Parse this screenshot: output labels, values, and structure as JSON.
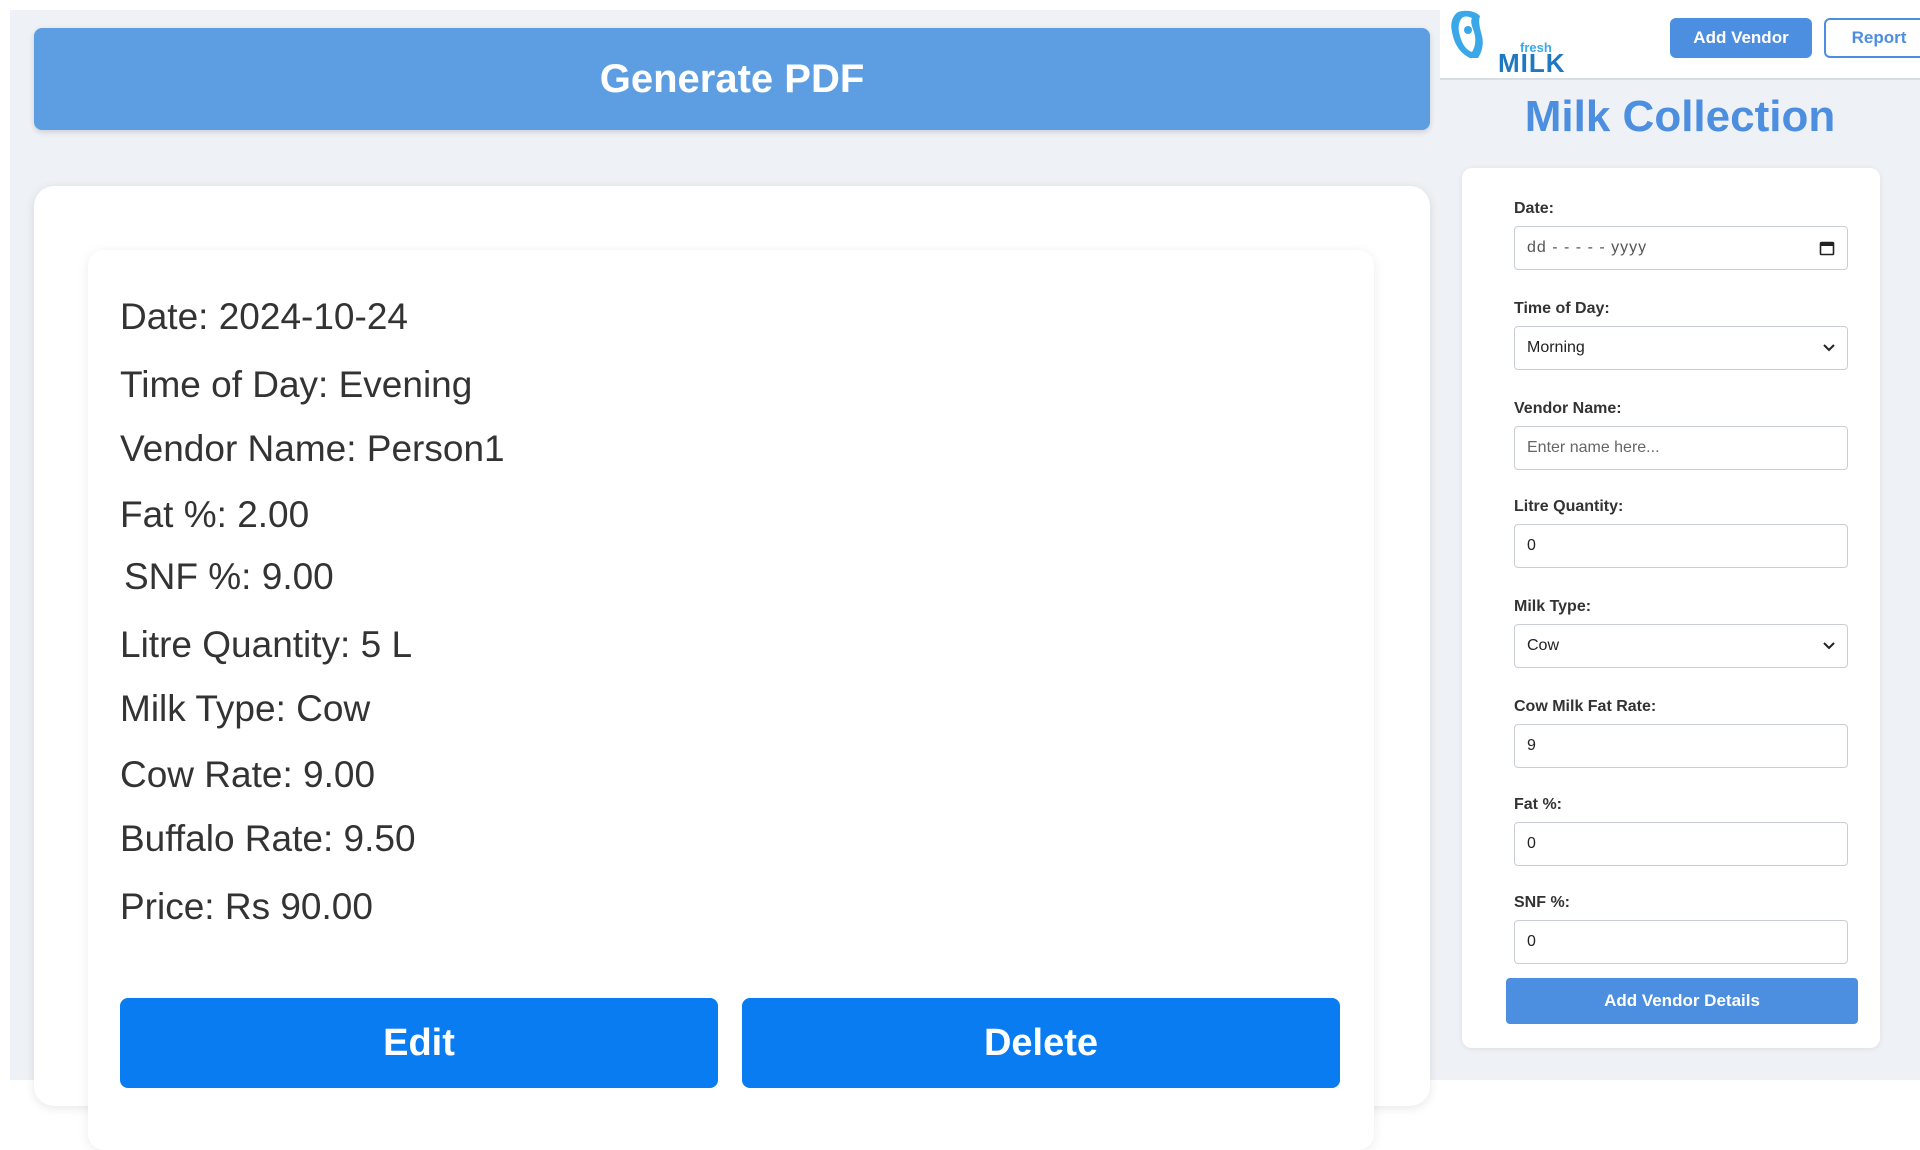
{
  "toolbar": {
    "generate_pdf_label": "Generate PDF"
  },
  "entry": {
    "lines": [
      "Date: 2024-10-24",
      "Time of Day: Evening",
      "Vendor Name: Person1",
      "Fat %: 2.00",
      "SNF %: 9.00",
      "Litre Quantity: 5 L",
      "Milk Type: Cow",
      "Cow Rate: 9.00",
      "Buffalo Rate: 9.50",
      "Price: Rs 90.00"
    ],
    "edit_label": "Edit",
    "delete_label": "Delete"
  },
  "header": {
    "logo_fresh": "fresh",
    "logo_milk": "MILK",
    "add_vendor_label": "Add Vendor",
    "report_label": "Report"
  },
  "form": {
    "title": "Milk Collection",
    "date_label": "Date:",
    "date_placeholder": "dd - - - - - yyyy",
    "time_label": "Time of Day:",
    "time_value": "Morning",
    "vendor_label": "Vendor Name:",
    "vendor_placeholder": "Enter name here...",
    "litre_label": "Litre Quantity:",
    "litre_value": "0",
    "milk_type_label": "Milk Type:",
    "milk_type_value": "Cow",
    "cow_rate_label": "Cow Milk Fat Rate:",
    "cow_rate_value": "9",
    "fat_label": "Fat %:",
    "fat_value": "0",
    "snf_label": "SNF %:",
    "snf_value": "0",
    "submit_label": "Add Vendor Details"
  },
  "colors": {
    "accent": "#4c8ee0",
    "primary_button": "#0a7cf2",
    "generate_pdf": "#5d9ee2",
    "page_bg": "#eef1f5"
  },
  "icons": [
    "calendar-icon",
    "chevron-down-icon",
    "milk-logo-icon"
  ]
}
